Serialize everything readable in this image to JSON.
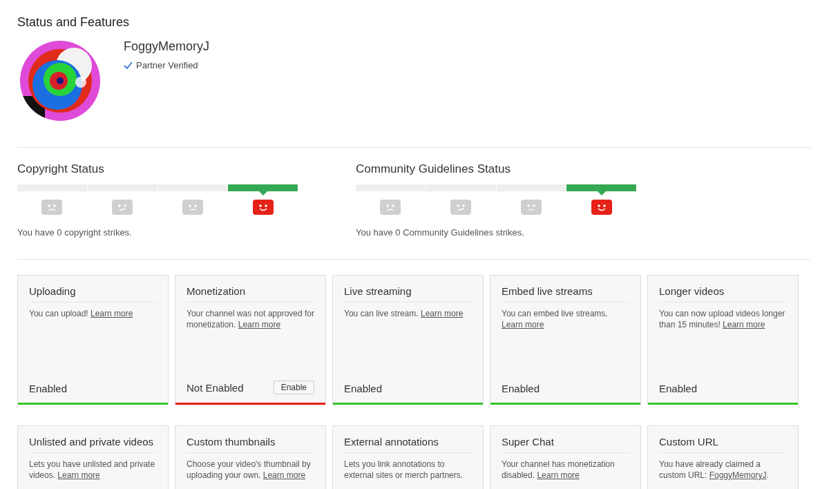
{
  "page_title": "Status and Features",
  "profile": {
    "kind": "picture",
    "name": "FoggyMemoryJ",
    "verified": true,
    "verified_label": "Partner Verified"
  },
  "strike_meters": [
    {
      "title": "Copyright Status",
      "segments": [
        {
          "kind": "sad",
          "selected": false
        },
        {
          "kind": "skeptical",
          "selected": false
        },
        {
          "kind": "neutral",
          "selected": false
        },
        {
          "kind": "happy",
          "selected": true
        }
      ],
      "summary": "You have 0 copyright strikes."
    },
    {
      "title": "Community Guidelines Status",
      "segments": [
        {
          "kind": "sad",
          "selected": false
        },
        {
          "kind": "skeptical",
          "selected": false
        },
        {
          "kind": "neutral",
          "selected": false
        },
        {
          "kind": "happy",
          "selected": true
        }
      ],
      "summary": "You have 0 Community Guidelines strikes."
    }
  ],
  "features": [
    {
      "title": "Uploading",
      "text": "You can upload! ",
      "link": "Learn more",
      "status": "Enabled",
      "enabled": true
    },
    {
      "title": "Monetization",
      "text": "Your channel was not approved for monetization. ",
      "link": "Learn more",
      "status": "Not Enabled",
      "enabled": false,
      "button": "Enable"
    },
    {
      "title": "Live streaming",
      "text": "You can live stream. ",
      "link": "Learn more",
      "status": "Enabled",
      "enabled": true
    },
    {
      "title": "Embed live streams",
      "text": "You can embed live streams. ",
      "link": "Learn more",
      "status": "Enabled",
      "enabled": true
    },
    {
      "title": "Longer videos",
      "text": "You can now upload videos longer than 15 minutes! ",
      "link": "Learn more",
      "status": "Enabled",
      "enabled": true
    },
    {
      "title": "Unlisted and private videos",
      "text": "Lets you have unlisted and private videos. ",
      "link": "Learn more"
    },
    {
      "title": "Custom thumbnails",
      "text": "Choose your video's thumbnail by uploading your own. ",
      "link": "Learn more"
    },
    {
      "title": "External annotations",
      "text": "Lets you link annotations to external sites or merch partners."
    },
    {
      "title": "Super Chat",
      "text": "Your channel has monetization disabled. ",
      "link": "Learn more"
    },
    {
      "title": "Custom URL",
      "text": "You have already claimed a custom URL: ",
      "link": "FoggyMemoryJ",
      "after": "."
    }
  ]
}
